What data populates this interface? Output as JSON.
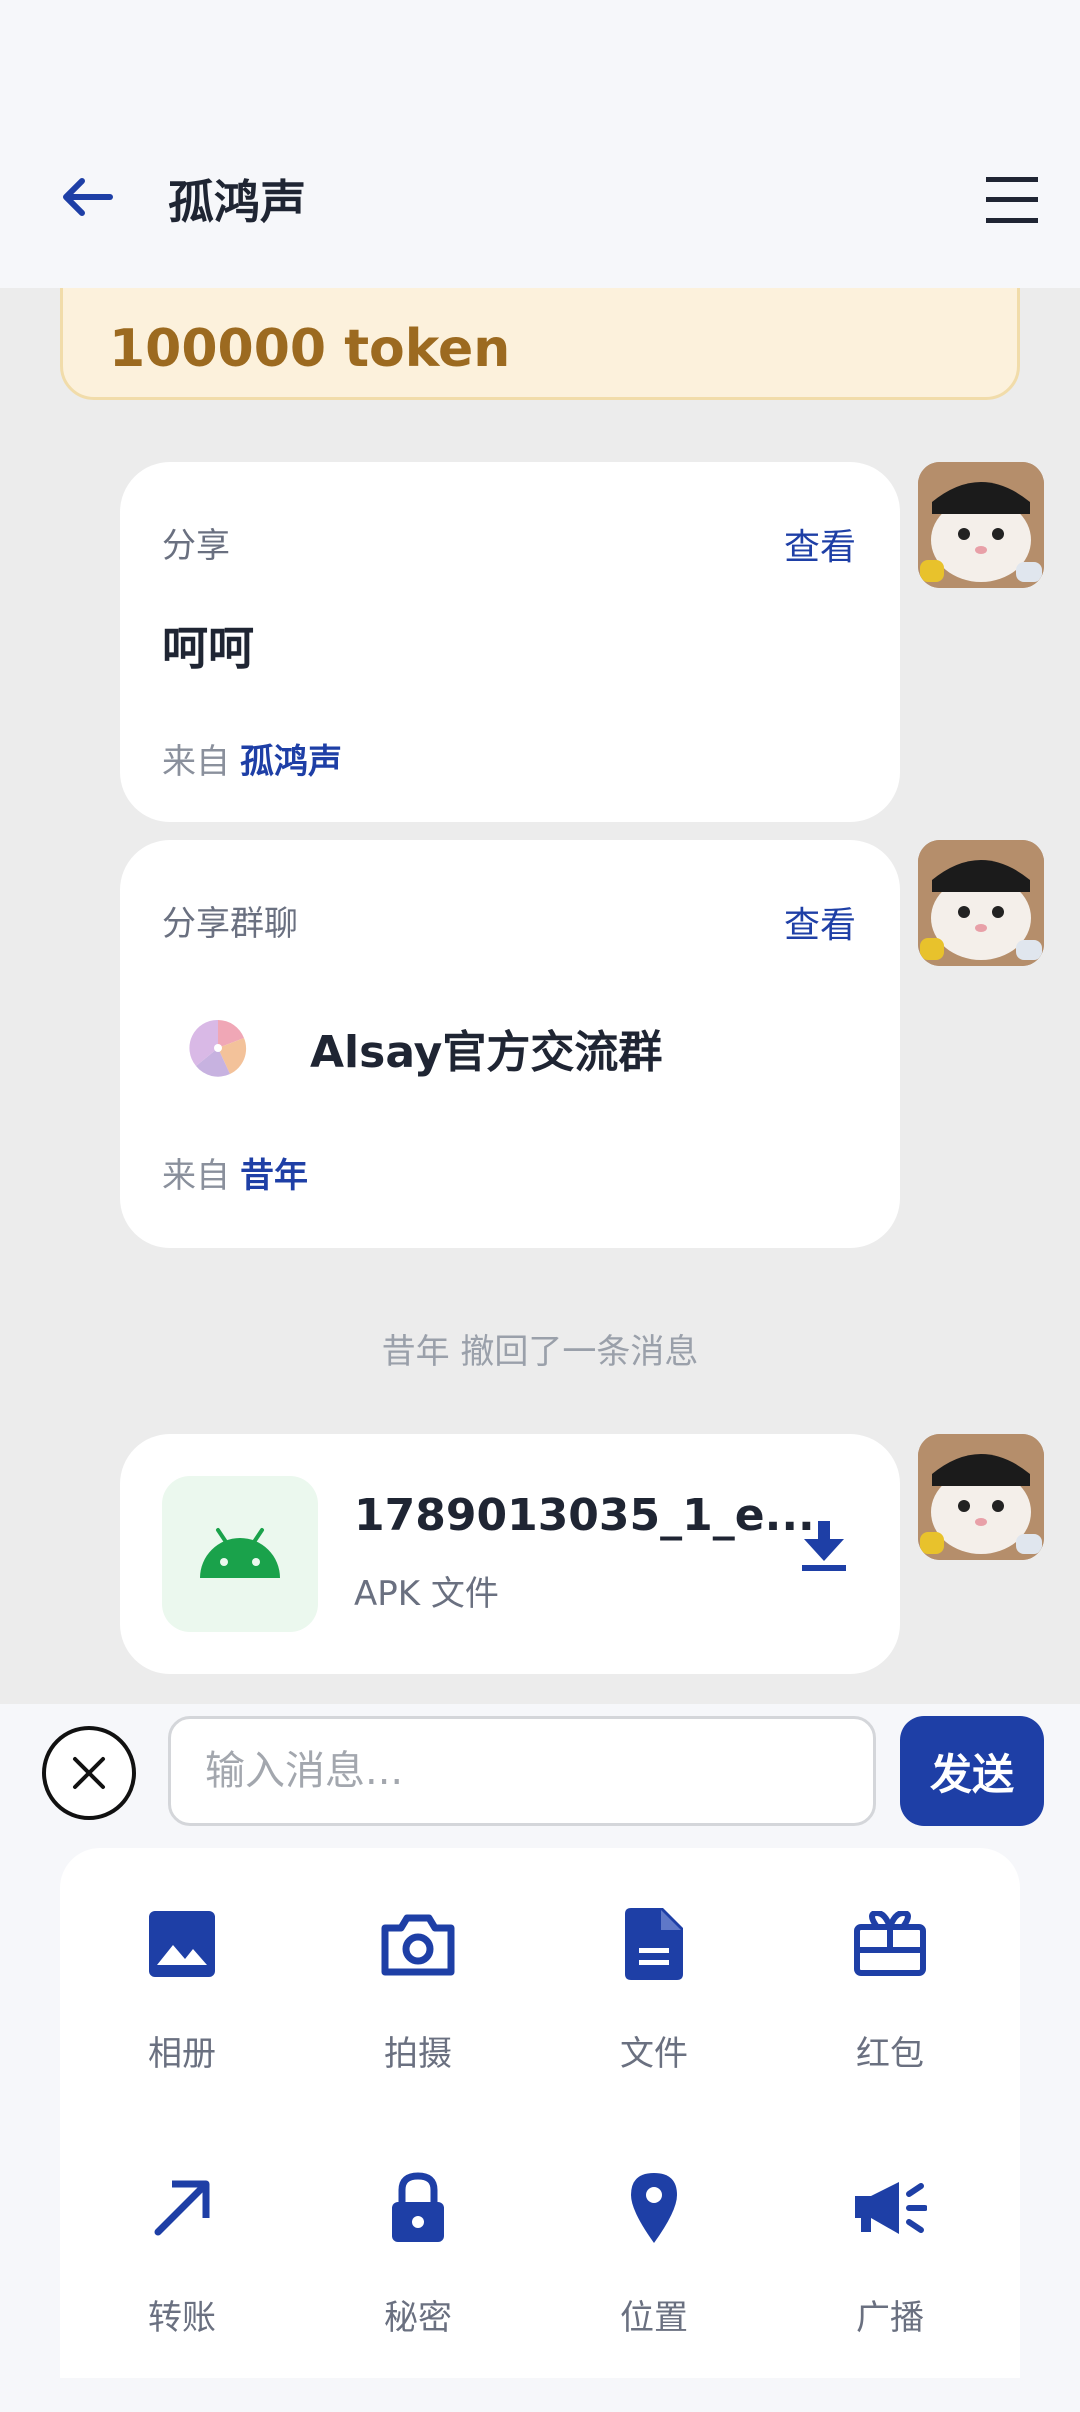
{
  "header": {
    "title": "孤鸿声"
  },
  "token_card": {
    "text": "100000 token"
  },
  "messages": {
    "share": {
      "type_label": "分享",
      "view_label": "查看",
      "content": "呵呵",
      "from_prefix": "来自",
      "from_name": "孤鸿声"
    },
    "group_share": {
      "type_label": "分享群聊",
      "view_label": "查看",
      "group_name": "Alsay官方交流群",
      "from_prefix": "来自",
      "from_name": "昔年"
    },
    "system": {
      "text": "昔年 撤回了一条消息"
    },
    "file": {
      "name": "1789013035_1_e...",
      "type": "APK 文件"
    }
  },
  "input": {
    "placeholder": "输入消息...",
    "send_label": "发送"
  },
  "panel": {
    "items": [
      {
        "label": "相册",
        "icon": "image-icon"
      },
      {
        "label": "拍摄",
        "icon": "camera-icon"
      },
      {
        "label": "文件",
        "icon": "file-icon"
      },
      {
        "label": "红包",
        "icon": "gift-icon"
      },
      {
        "label": "转账",
        "icon": "arrow-up-right-icon"
      },
      {
        "label": "秘密",
        "icon": "lock-icon"
      },
      {
        "label": "位置",
        "icon": "location-icon"
      },
      {
        "label": "广播",
        "icon": "megaphone-icon"
      }
    ]
  },
  "colors": {
    "accent": "#1e3fa6",
    "header_bg": "#f6f7fa",
    "chat_bg": "#ececec",
    "token_bg": "#fcf1dc",
    "token_text": "#9c6a20",
    "android_green": "#1aa24b"
  }
}
